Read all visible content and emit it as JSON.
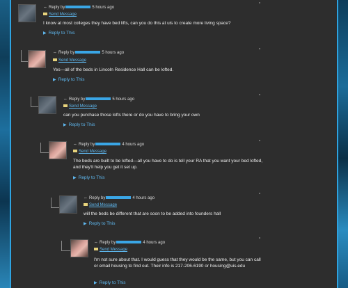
{
  "comments": [
    {
      "time": "5 hours ago",
      "reply_by": "Reply by",
      "send": "Send Message",
      "text": "I know at most colleges they have bed lifts, can you do this at uis to create more living space?",
      "reply_link": "Reply to This"
    },
    {
      "time": "5 hours ago",
      "reply_by": "Reply by",
      "send": "Send Message",
      "text": "Yes—all of the beds in Lincoln Residence Hall can be lofted.",
      "reply_link": "Reply to This"
    },
    {
      "time": "5 hours ago",
      "reply_by": "Reply by",
      "send": "Send Message",
      "text": "can you purchase those lofts there or do you have to bring your own",
      "reply_link": "Reply to This"
    },
    {
      "time": "4 hours ago",
      "reply_by": "Reply by",
      "send": "Send Message",
      "text": "The beds are built to be lofted—all you have to do is tell your RA that you want your bed lofted, and they'll help you get it set up.",
      "reply_link": "Reply to This"
    },
    {
      "time": "4 hours ago",
      "reply_by": "Reply by",
      "send": "Send Message",
      "text": "will the beds be different that are soon to be added into founders hall",
      "reply_link": "Reply to This"
    },
    {
      "time": "4 hours ago",
      "reply_by": "Reply by",
      "send": "Send Message",
      "text": "I'm not sure about that. I would guess that they would be the same, but you can call or email housing to find out. Their info is 217-206-6190 or housing@uis.edu",
      "reply_link": "Reply to This"
    }
  ],
  "icons": {
    "link": "link-icon",
    "envelope": "envelope-icon",
    "reply": "triangle-right-icon"
  },
  "colors": {
    "accent": "#2ea3e0",
    "link": "#5fb8ef",
    "panel": "#2d2d2d"
  }
}
